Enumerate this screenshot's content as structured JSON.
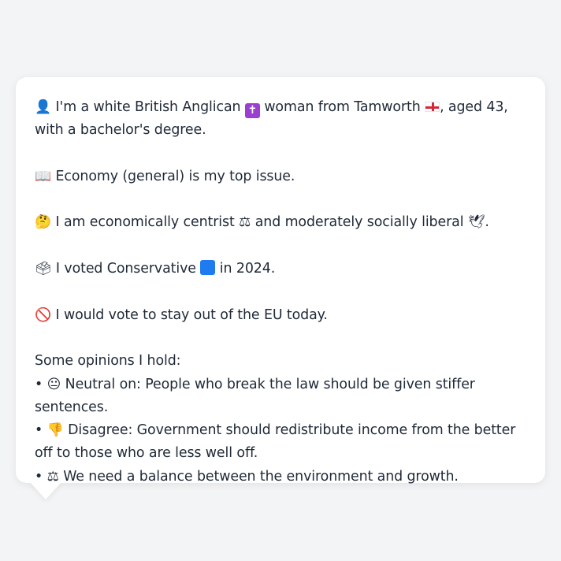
{
  "message": {
    "p1": {
      "icon": "👤",
      "text_a": "I'm a white British Anglican",
      "icon_religion": "✝",
      "text_b": "woman from Tamworth",
      "icon_flag": "england-flag",
      "text_c": ", aged 43, with a bachelor's degree."
    },
    "p2": {
      "icon": "📖",
      "text": "Economy (general) is my top issue."
    },
    "p3": {
      "icon": "🤔",
      "text_a": "I am economically centrist",
      "icon_scale": "⚖",
      "text_b": "and moderately socially liberal",
      "icon_dove": "🕊",
      "text_c": "."
    },
    "p4": {
      "icon": "🗳",
      "text_a": "I voted Conservative",
      "icon_square": "blue-square",
      "text_b": "in 2024."
    },
    "p5": {
      "icon": "🚫",
      "text": "I would vote to stay out of the EU today."
    },
    "opinions": {
      "heading": "Some opinions I hold:",
      "bullet": "•",
      "items": [
        {
          "icon": "😐",
          "text": "Neutral on: People who break the law should be given stiffer sentences."
        },
        {
          "icon": "👎",
          "text": "Disagree: Government should redistribute income from the better off to those who are less well off."
        },
        {
          "icon": "⚖",
          "text": "We need a balance between the environment and growth."
        }
      ]
    }
  },
  "colors": {
    "background": "#f3f4f6",
    "bubble": "#ffffff",
    "text": "#1f2937",
    "flag_red": "#d72638",
    "conservative_blue": "#1e7bf0",
    "religion_purple": "#9b3fd1"
  }
}
